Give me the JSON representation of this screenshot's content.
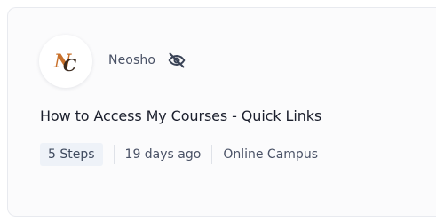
{
  "card": {
    "source": {
      "logo_text": "NC",
      "name": "Neosho",
      "visibility_icon": "eye-off-icon"
    },
    "title": "How to Access My Courses - Quick Links",
    "meta": {
      "steps": "5 Steps",
      "age": "19 days ago",
      "location": "Online Campus"
    }
  },
  "colors": {
    "logo_orange": "#c8702a",
    "logo_dark": "#3b2a1e",
    "badge_bg": "#eef2f8",
    "card_bg": "#fbfbfc",
    "text_primary": "#1b1f2d",
    "text_secondary": "#4a5266"
  }
}
